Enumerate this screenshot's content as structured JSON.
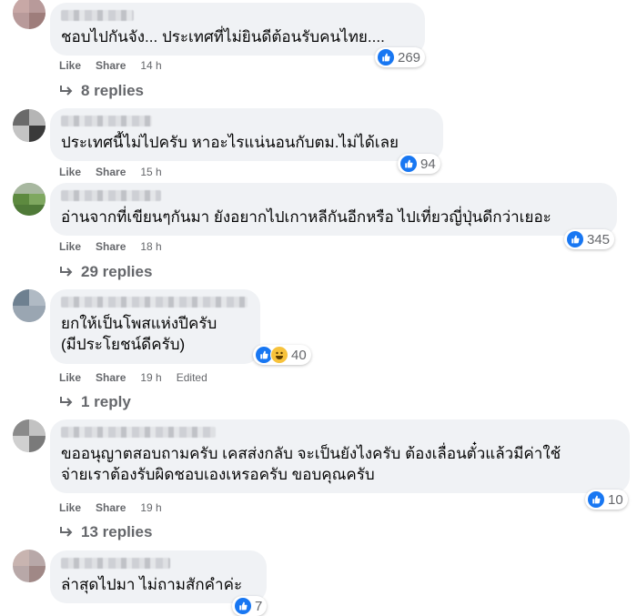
{
  "labels": {
    "like": "Like",
    "share": "Share",
    "edited": "Edited"
  },
  "comments": [
    {
      "text": "ชอบไปกันจัง... ประเทศที่ไม่ยินดีต้อนรับคนไทย....",
      "reactions": "269",
      "time": "14 h",
      "replies": "8 replies"
    },
    {
      "text": "ประเทศนี้ไม่ไปครับ หาอะไรแน่นอนกับตม.ไม่ได้เลย",
      "reactions": "94",
      "time": "15 h",
      "replies": ""
    },
    {
      "text": "อ่านจากที่เขียนๆกันมา ยังอยากไปเกาหลีกันอีกหรือ ไปเที่ยวญี่ปุ่นดีกว่าเยอะ",
      "reactions": "345",
      "time": "18 h",
      "replies": "29 replies"
    },
    {
      "text": "ยกให้เป็นโพสแห่งปีครับ\n(มีประโยชน์ดีครับ)",
      "reactions": "40",
      "time": "19 h",
      "replies": "1 reply"
    },
    {
      "text": "ขออนุญาตสอบถามครับ เคสส่งกลับ จะเป็นยังไงครับ ต้องเลื่อนตั๋วแล้วมีค่าใช้\nจ่ายเราต้องรับผิดชอบเองเหรอครับ ขอบคุณครับ",
      "reactions": "10",
      "time": "19 h",
      "replies": "13 replies"
    },
    {
      "text": "ล่าสุดไปมา ไม่ถามสักคำค่ะ",
      "reactions": "7",
      "time": "",
      "replies": ""
    }
  ],
  "colors": {
    "like_blue": "#1877f2",
    "bubble": "#f0f2f5",
    "meta": "#65676b"
  }
}
